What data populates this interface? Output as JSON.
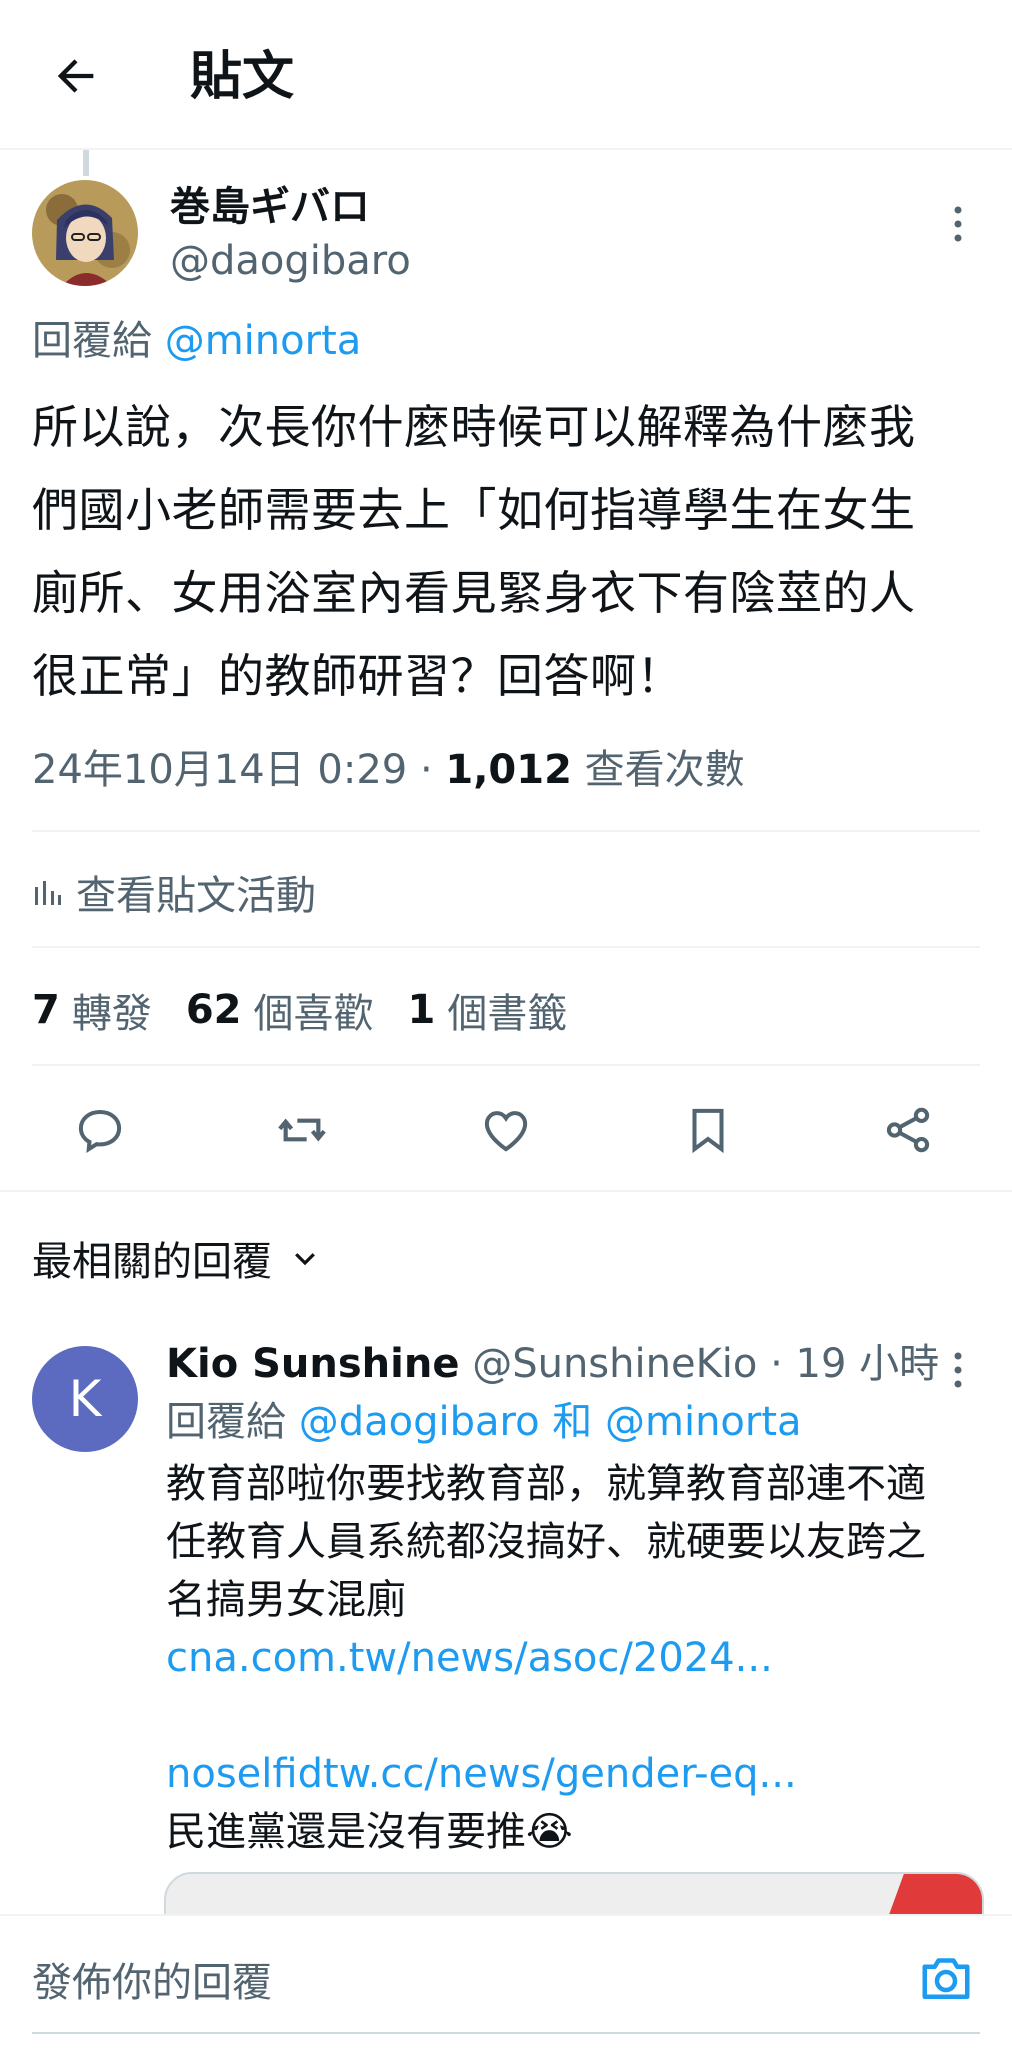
{
  "header": {
    "back_icon": "arrow-left-icon",
    "title": "貼文"
  },
  "post": {
    "author_name": "巻島ギバロ",
    "author_handle": "@daogibaro",
    "reply_to_label": "回覆給",
    "reply_to_handle": "@minorta",
    "body_lines": [
      "所以說，次長你什麼時候可以解釋為什麼我",
      "們國小老師需要去上「如何指導學生在女生",
      "廁所、女用浴室內看見緊身衣下有陰莖的人",
      "很正常」的教師研習？回答啊！"
    ],
    "timestamp": "24年10月14日 0:29 · ",
    "views_count": "1,012",
    "views_label": " 查看次數",
    "activity_label": "查看貼文活動",
    "stats": {
      "retweets_count": "7",
      "retweets_label": "轉發",
      "likes_count": "62",
      "likes_label": "個喜歡",
      "bookmarks_count": "1",
      "bookmarks_label": "個書籤"
    },
    "actions": [
      "reply-icon",
      "retweet-icon",
      "like-icon",
      "bookmark-icon",
      "share-icon"
    ]
  },
  "replies_header": {
    "label": "最相關的回覆",
    "icon": "chevron-down-icon"
  },
  "reply": {
    "avatar_letter": "K",
    "name": "Kio Sunshine",
    "handle": "@SunshineKio",
    "time": " · 19 小時",
    "reply_to_label": "回覆給",
    "reply_to_handle_1": "@daogibaro",
    "and_label": " 和 ",
    "reply_to_handle_2": "@minorta",
    "body_lines": [
      "教育部啦你要找教育部，就算教育部連不適",
      "任教育人員系統都沒搞好、就硬要以友跨之",
      "名搞男女混廁"
    ],
    "link_1": "cna.com.tw/news/asoc/2024...",
    "link_2": "noselfidtw.cc/news/gender-eq...",
    "last_line": "民進黨還是沒有要推😭"
  },
  "composer": {
    "placeholder": "發佈你的回覆",
    "camera_icon": "camera-icon"
  },
  "colors": {
    "accent": "#1d9bf0",
    "muted": "#536471",
    "text": "#0f1419",
    "divider": "#eff3f4"
  }
}
